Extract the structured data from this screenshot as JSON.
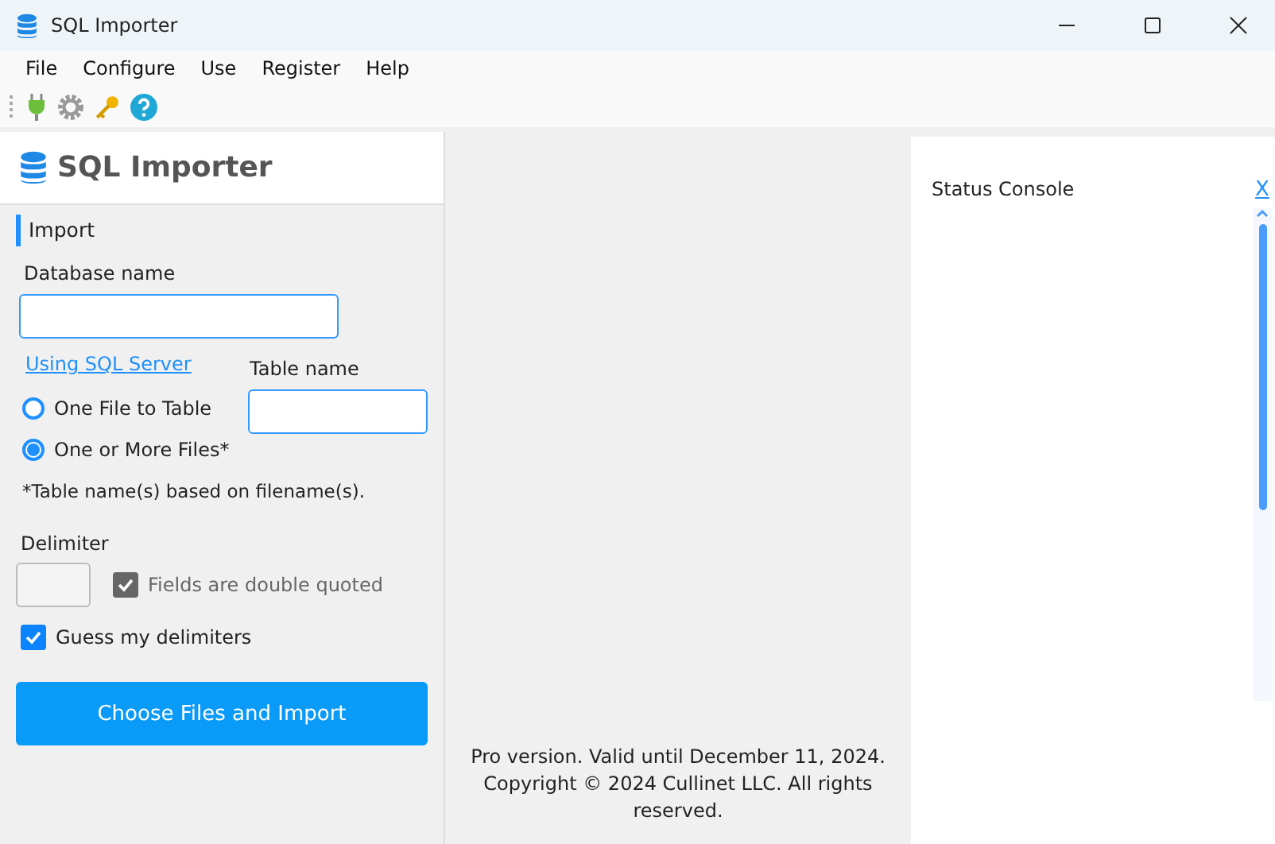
{
  "window": {
    "title": "SQL Importer"
  },
  "menu": [
    "File",
    "Configure",
    "Use",
    "Register",
    "Help"
  ],
  "sidebar": {
    "title": "SQL Importer",
    "section": "Import",
    "database_label": "Database name",
    "server_link": "Using SQL Server",
    "table_label": "Table name",
    "modes": [
      {
        "label": "One File to Table",
        "selected": false
      },
      {
        "label": "One or More Files*",
        "selected": true
      }
    ],
    "note": "*Table name(s) based on filename(s).",
    "delimiter_label": "Delimiter",
    "options": [
      {
        "label": "Fields are double quoted",
        "checked": true,
        "disabled": true
      },
      {
        "label": "Guess my delimiters",
        "checked": true,
        "disabled": false
      }
    ],
    "button": "Choose Files and Import"
  },
  "footer": [
    "Pro version. Valid until December 11, 2024.",
    "Copyright © 2024 Cullinet LLC. All rights reserved."
  ],
  "console": {
    "title": "Status Console",
    "close": "X"
  }
}
